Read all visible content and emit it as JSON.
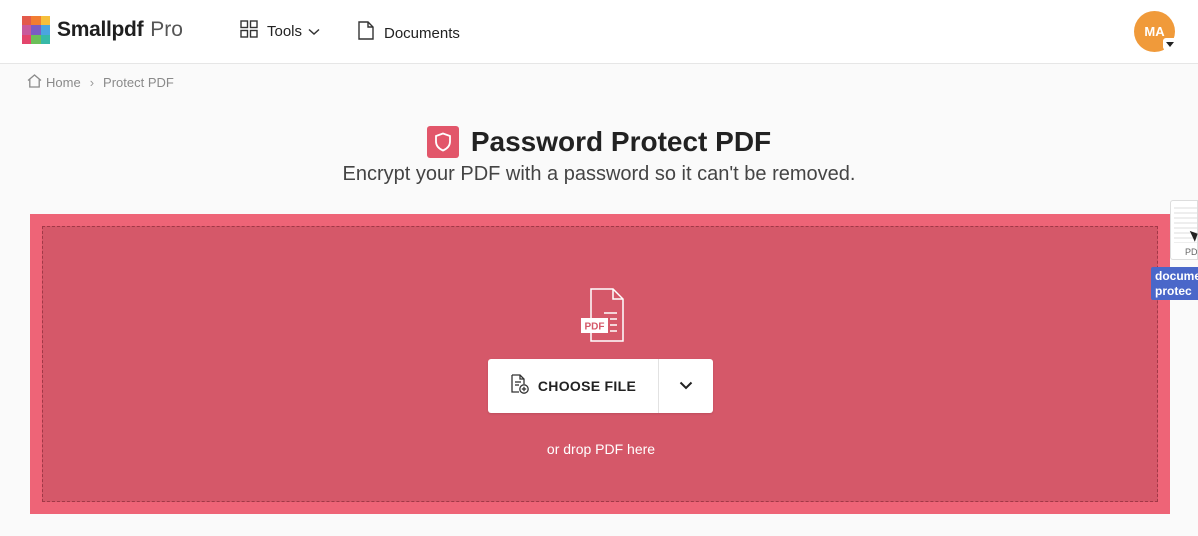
{
  "header": {
    "brand": "Smallpdf",
    "brand_plan": "Pro",
    "nav": {
      "tools_label": "Tools",
      "documents_label": "Documents"
    },
    "avatar_initials": "MA",
    "logo_colors": [
      "#e35a4b",
      "#f27d32",
      "#f6bf3b",
      "#c85a9c",
      "#7b5cc4",
      "#4aa5e0",
      "#e3456c",
      "#6bbf59",
      "#37b9a8"
    ]
  },
  "breadcrumb": {
    "home_label": "Home",
    "separator": "›",
    "current_label": "Protect PDF"
  },
  "page": {
    "title": "Password Protect PDF",
    "subtitle": "Encrypt your PDF with a password so it can't be removed.",
    "accent_color": "#ee6477"
  },
  "dropzone": {
    "file_badge": "PDF",
    "choose_file_label": "CHOOSE FILE",
    "drop_hint": "or drop PDF here"
  },
  "drag_overlay": {
    "thumb_label": "PD",
    "tag_line1": "docume",
    "tag_line2": "protec"
  },
  "icons": {
    "logo": "smallpdf-logo-icon",
    "tools": "grid-icon",
    "documents": "document-icon",
    "home": "home-icon",
    "title": "shield-icon",
    "choose": "add-file-icon",
    "more": "chevron-down-icon"
  }
}
